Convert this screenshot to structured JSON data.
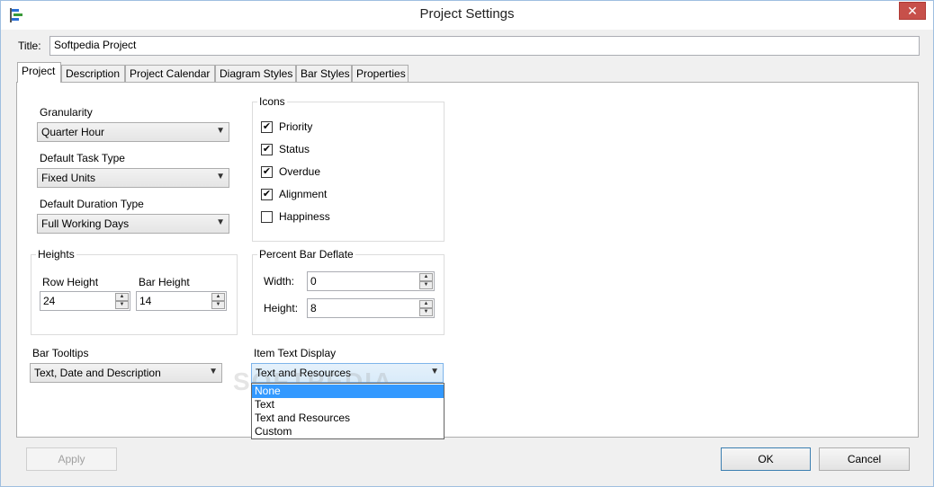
{
  "window": {
    "title": "Project Settings",
    "close_glyph": "✕",
    "app_icon": "gantt-chart-icon"
  },
  "title_field": {
    "label": "Title:",
    "value": "Softpedia Project"
  },
  "tabs": [
    {
      "label": "Project"
    },
    {
      "label": "Description"
    },
    {
      "label": "Project Calendar"
    },
    {
      "label": "Diagram Styles"
    },
    {
      "label": "Bar Styles"
    },
    {
      "label": "Properties"
    }
  ],
  "granularity": {
    "label": "Granularity",
    "value": "Quarter Hour"
  },
  "task_type": {
    "label": "Default Task Type",
    "value": "Fixed Units"
  },
  "duration_type": {
    "label": "Default Duration Type",
    "value": "Full Working Days"
  },
  "icons": {
    "title": "Icons",
    "items": [
      {
        "label": "Priority",
        "checked": "✔"
      },
      {
        "label": "Status",
        "checked": "✔"
      },
      {
        "label": "Overdue",
        "checked": "✔"
      },
      {
        "label": "Alignment",
        "checked": "✔"
      },
      {
        "label": "Happiness",
        "checked": ""
      }
    ]
  },
  "heights": {
    "title": "Heights",
    "row_label": "Row Height",
    "row_value": "24",
    "bar_label": "Bar Height",
    "bar_value": "14"
  },
  "deflate": {
    "title": "Percent Bar Deflate",
    "width_label": "Width:",
    "width_value": "0",
    "height_label": "Height:",
    "height_value": "8"
  },
  "bar_tooltips": {
    "label": "Bar Tooltips",
    "value": "Text, Date and Description"
  },
  "item_text": {
    "label": "Item Text Display",
    "value": "Text and Resources",
    "options": [
      "None",
      "Text",
      "Text and Resources",
      "Custom"
    ]
  },
  "watermark": "SOFTPEDIA",
  "buttons": {
    "apply": "Apply",
    "ok": "OK",
    "cancel": "Cancel"
  },
  "colors": {
    "selection": "#3399ff",
    "close": "#c7504a"
  }
}
